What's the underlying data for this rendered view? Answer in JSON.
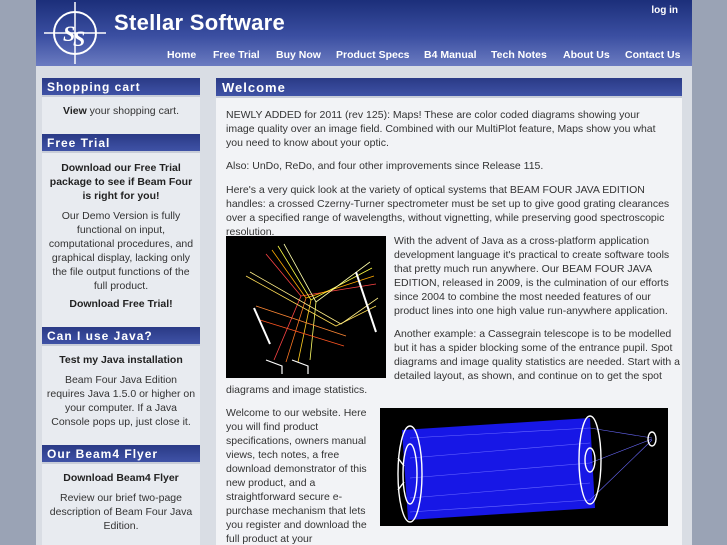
{
  "header": {
    "site_title": "Stellar Software",
    "logo_alt": "SS",
    "login_label": "log in",
    "nav": [
      "Home",
      "Free Trial",
      "Buy Now",
      "Product Specs",
      "B4 Manual",
      "Tech Notes",
      "About Us",
      "Contact Us"
    ]
  },
  "sidebar": {
    "cart": {
      "heading": "Shopping cart",
      "link": "View",
      "text": " your shopping cart."
    },
    "trial": {
      "heading": "Free Trial",
      "bold_text": "Download our Free Trial package to see if Beam Four is right for you!",
      "text": "Our Demo Version is fully functional on input, computational procedures, and graphical display, lacking only the file output functions of the full product.",
      "link": "Download Free Trial!"
    },
    "java": {
      "heading": "Can I use Java?",
      "link": "Test my Java installation",
      "text": "Beam Four Java Edition requires Java 1.5.0 or higher on your computer. If a Java Console pops up, just close it."
    },
    "flyer": {
      "heading": "Our Beam4 Flyer",
      "link": "Download Beam4 Flyer",
      "text": "Review our brief two-page description of Beam Four Java Edition."
    }
  },
  "main": {
    "heading": "Welcome",
    "p1": "NEWLY ADDED for 2011 (rev 125): Maps! These are color coded diagrams showing your image quality over an image field. Combined with our MultiPlot feature, Maps show you what you need to know about your optic.",
    "p2": "Also: UnDo, ReDo, and four other improvements since Release 115.",
    "p3": "Here's a very quick look at the variety of optical systems that BEAM FOUR JAVA EDITION handles: a crossed Czerny-Turner spectrometer must be set up to give good grating clearances over a specified range of wavelengths, without vignetting, while preserving good spectroscopic resolution.",
    "p4": "With the advent of Java as a cross-platform application development language it's practical to create software tools that pretty much run anywhere. Our BEAM FOUR JAVA EDITION, released in 2009, is the culmination of our efforts since 2004 to combine the most needed features of our product lines into one high value run-anywhere application.",
    "p5a": "Another example: a Cassegrain telescope is to be modelled but it has a spider blocking some of the entrance pupil. Spot diagrams and image quality statistics are needed. Start with a detailed layout, as shown, and continue on to get the spot",
    "p5b": "diagrams and image statistics.",
    "p6": "Welcome to our website. Here you will find product specifications, owners manual views, tech notes, a free download demonstrator of this new product, and a straightforward secure e-purchase mechanism that lets you register and download the full product at your convenience."
  },
  "colors": {
    "header_dark": "#1c2f7a",
    "heading_bar": "#2a3a86",
    "page_bg": "#9aa3b5"
  }
}
